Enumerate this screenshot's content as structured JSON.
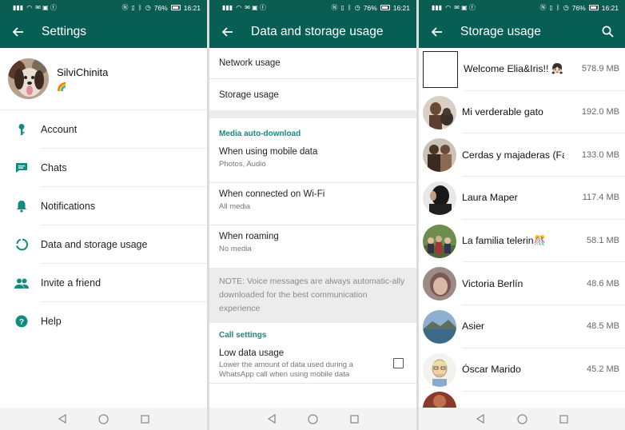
{
  "status_bar": {
    "battery": "76%",
    "time": "16:21"
  },
  "settings": {
    "title": "Settings",
    "profile": {
      "name": "SilviChinita",
      "status": "🌈"
    },
    "items": [
      {
        "label": "Account",
        "icon": "key-icon"
      },
      {
        "label": "Chats",
        "icon": "chat-icon"
      },
      {
        "label": "Notifications",
        "icon": "bell-icon"
      },
      {
        "label": "Data and storage usage",
        "icon": "data-usage-icon"
      },
      {
        "label": "Invite a friend",
        "icon": "people-icon"
      },
      {
        "label": "Help",
        "icon": "help-icon"
      }
    ]
  },
  "data_storage": {
    "title": "Data and storage usage",
    "network_usage": "Network usage",
    "storage_usage": "Storage usage",
    "media_header": "Media auto-download",
    "mobile": {
      "label": "When using mobile data",
      "value": "Photos, Audio"
    },
    "wifi": {
      "label": "When connected on Wi-Fi",
      "value": "All media"
    },
    "roaming": {
      "label": "When roaming",
      "value": "No media"
    },
    "note": "NOTE: Voice messages are always automatic-ally downloaded for the best communication experience",
    "call_header": "Call settings",
    "low_data": {
      "label": "Low data usage",
      "desc": "Lower the amount of data used during a WhatsApp call when using mobile data",
      "checked": false
    }
  },
  "storage": {
    "title": "Storage usage",
    "chats": [
      {
        "name": "Welcome Elia&Iris!! 👧🏻 👶🏻",
        "size": "578.9 MB"
      },
      {
        "name": "Mi verderable gato",
        "size": "192.0 MB"
      },
      {
        "name": "Cerdas y majaderas (Fan…",
        "size": "133.0 MB"
      },
      {
        "name": "Laura Maper",
        "size": "117.4 MB"
      },
      {
        "name": "La familia telerin🎊",
        "size": "58.1 MB"
      },
      {
        "name": "Victoria Berlín",
        "size": "48.6 MB"
      },
      {
        "name": "Asier",
        "size": "48.5 MB"
      },
      {
        "name": "Óscar Marido",
        "size": "45.2 MB"
      }
    ]
  },
  "colors": {
    "header": "#075e54",
    "status_bar": "#0b5d52",
    "accent": "#128c7e"
  }
}
